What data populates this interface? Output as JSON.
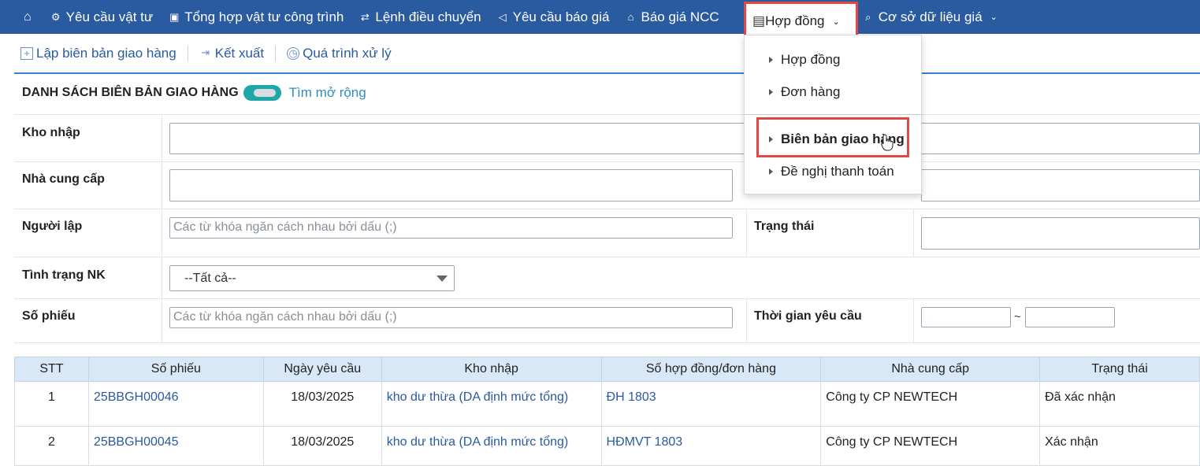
{
  "nav": {
    "items": [
      {
        "label": "Yêu cầu vật tư",
        "icon": "settings-icon"
      },
      {
        "label": "Tổng hợp vật tư công trình",
        "icon": "image-icon"
      },
      {
        "label": "Lệnh điều chuyển",
        "icon": "transfer-icon"
      },
      {
        "label": "Yêu cầu báo giá",
        "icon": "megaphone-icon"
      },
      {
        "label": "Báo giá NCC",
        "icon": "building-icon"
      },
      {
        "label": "Cơ sở dữ liệu giá",
        "icon": "database-search-icon"
      }
    ],
    "active": {
      "label": "Hợp đồng",
      "icon": "document-icon"
    }
  },
  "toolbar": {
    "create": "Lập biên bản giao hàng",
    "export": "Kết xuất",
    "history": "Quá trình xử lý"
  },
  "list": {
    "title": "DANH SÁCH BIÊN BẢN GIAO HÀNG",
    "expand_search": "Tìm mở rộng"
  },
  "filters": {
    "warehouse_label": "Kho nhập",
    "supplier_label": "Nhà cung cấp",
    "creator_label": "Người lập",
    "creator_placeholder": "Các từ khóa ngăn cách nhau bởi dấu (;)",
    "status_label": "Trạng thái",
    "import_status_label": "Tình trạng NK",
    "import_status_value": "--Tất cả--",
    "ticket_no_label": "Số phiếu",
    "ticket_no_placeholder": "Các từ khóa ngăn cách nhau bởi dấu (;)",
    "request_time_label": "Thời gian yêu cầu",
    "range_separator": "~"
  },
  "table": {
    "columns": [
      "STT",
      "Số phiếu",
      "Ngày yêu cầu",
      "Kho nhập",
      "Số hợp đồng/đơn hàng",
      "Nhà cung cấp",
      "Trạng thái"
    ],
    "rows": [
      {
        "stt": "1",
        "ticket": "25BBGH00046",
        "date": "18/03/2025",
        "warehouse": "kho dư thừa (DA định mức tổng)",
        "contract": "ĐH 1803",
        "supplier": "Công ty CP NEWTECH",
        "status": "Đã xác nhận"
      },
      {
        "stt": "2",
        "ticket": "25BBGH00045",
        "date": "18/03/2025",
        "warehouse": "kho dư thừa (DA định mức tổng)",
        "contract": "HĐMVT 1803",
        "supplier": "Công ty CP NEWTECH",
        "status": "Xác nhận"
      }
    ]
  },
  "dropdown": {
    "items": [
      "Hợp đồng",
      "Đơn hàng",
      "Biên bản giao hàng",
      "Đề nghị thanh toán"
    ]
  },
  "colors": {
    "nav_bg": "#2a5aa0",
    "highlight": "#e04848",
    "link": "#2a5aa0",
    "toggle": "#1fa6a6",
    "table_header": "#d9e8f7"
  }
}
